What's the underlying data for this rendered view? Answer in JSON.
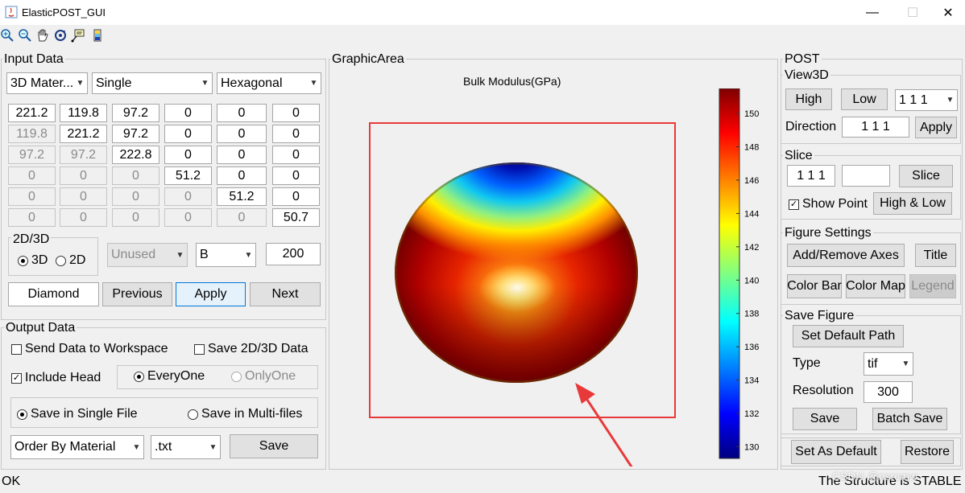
{
  "window": {
    "title": "ElasticPOST_GUI",
    "controls": [
      "—",
      "☐",
      "✕"
    ]
  },
  "toolbar": {
    "icons": [
      "zoom-in-icon",
      "zoom-out-icon",
      "pan-icon",
      "rotate-icon",
      "datatip-icon",
      "colorbar-icon"
    ]
  },
  "input": {
    "title": "Input Data",
    "type_select": "3D Mater...",
    "mode_select": "Single",
    "crystal_select": "Hexagonal",
    "matrix": [
      [
        "221.2",
        "119.8",
        "97.2",
        "0",
        "0",
        "0"
      ],
      [
        "119.8",
        "221.2",
        "97.2",
        "0",
        "0",
        "0"
      ],
      [
        "97.2",
        "97.2",
        "222.8",
        "0",
        "0",
        "0"
      ],
      [
        "0",
        "0",
        "0",
        "51.2",
        "0",
        "0"
      ],
      [
        "0",
        "0",
        "0",
        "0",
        "51.2",
        "0"
      ],
      [
        "0",
        "0",
        "0",
        "0",
        "0",
        "50.7"
      ]
    ],
    "dim_title": "2D/3D",
    "radio_3d": "3D",
    "radio_2d": "2D",
    "unused_select": "Unused",
    "prop_select": "B",
    "points_value": "200",
    "material_name": "Diamond",
    "previous_label": "Previous",
    "apply_label": "Apply",
    "next_label": "Next"
  },
  "output": {
    "title": "Output Data",
    "send_workspace": "Send Data to Workspace",
    "save_2d3d": "Save 2D/3D Data",
    "include_head": "Include Head",
    "everyone": "EveryOne",
    "onlyone": "OnlyOne",
    "single_file": "Save in Single File",
    "multi_files": "Save in Multi-files",
    "order_select": "Order By Material",
    "ext_select": ".txt",
    "save_label": "Save"
  },
  "graphic": {
    "title": "GraphicArea",
    "plot_title": "Bulk Modulus(GPa)",
    "colorbar_ticks": [
      "150",
      "148",
      "146",
      "144",
      "142",
      "140",
      "138",
      "136",
      "134",
      "132",
      "130"
    ],
    "colorbar_range": [
      129.3,
      151.5
    ],
    "annotation_color": "#e8393a"
  },
  "post": {
    "title": "POST",
    "view3d_title": "View3D",
    "high_label": "High",
    "low_label": "Low",
    "direction_select": "1 1 1",
    "direction_label": "Direction",
    "direction_value": "1 1 1",
    "apply_label": "Apply",
    "slice_title": "Slice",
    "slice_value": "1 1 1",
    "slice_value2": "",
    "slice_label": "Slice",
    "show_point": "Show Point",
    "high_low_label": "High & Low",
    "figset_title": "Figure Settings",
    "add_axes": "Add/Remove Axes",
    "title_btn": "Title",
    "color_bar": "Color Bar",
    "color_map": "Color Map",
    "legend": "Legend",
    "savefig_title": "Save Figure",
    "default_path": "Set Default Path",
    "type_label": "Type",
    "type_select": "tif",
    "res_label": "Resolution",
    "res_value": "300",
    "save_label": "Save",
    "batch_save": "Batch Save",
    "set_default": "Set As Default",
    "restore": "Restore"
  },
  "status": {
    "left": "OK",
    "right": "The Structure is STABLE",
    "watermark": "CSDN @nsrcmw"
  }
}
